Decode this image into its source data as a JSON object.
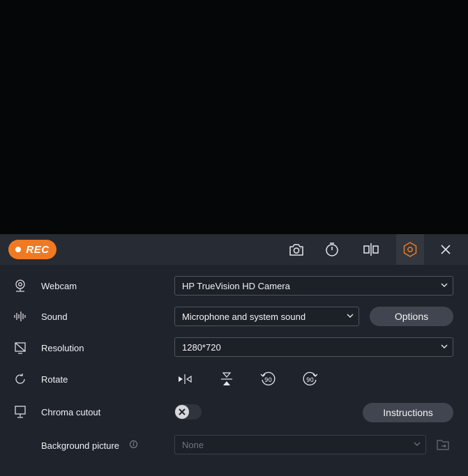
{
  "toolbar": {
    "rec_label": "REC",
    "icons": [
      "camera-icon",
      "timer-icon",
      "split-icon",
      "settings-hexagon-icon",
      "close-icon"
    ],
    "active_icon": "settings-hexagon-icon",
    "accent_color": "#f07a22"
  },
  "rows": {
    "webcam": {
      "label": "Webcam",
      "value": "HP TrueVision HD Camera"
    },
    "sound": {
      "label": "Sound",
      "value": "Microphone and system sound",
      "button": "Options"
    },
    "resolution": {
      "label": "Resolution",
      "value": "1280*720"
    },
    "rotate": {
      "label": "Rotate",
      "buttons": [
        "flip-horizontal-icon",
        "flip-vertical-icon",
        "rotate-left-90-icon",
        "rotate-right-90-icon"
      ],
      "rotate_text": "90"
    },
    "chroma": {
      "label": "Chroma cutout",
      "enabled": false,
      "button": "Instructions"
    },
    "background": {
      "label": "Background picture",
      "info": "i",
      "value": "None"
    }
  }
}
